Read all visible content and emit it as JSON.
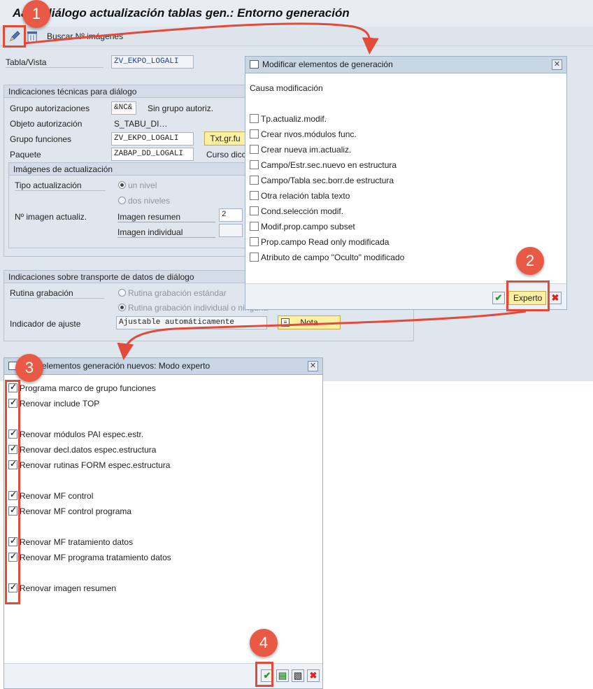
{
  "main": {
    "title": "Aa...l.diálogo actualización tablas gen.: Entorno generación",
    "toolbar": {
      "search_label": "Buscar Nº imágenes"
    },
    "table_view": {
      "label": "Tabla/Vista",
      "value": "ZV_EKPO_LOGALI"
    },
    "tech_group": {
      "title": "Indicaciones técnicas para diálogo",
      "auth_group_label": "Grupo autorizaciones",
      "auth_group_value": "&NC&",
      "auth_group_text": "Sin grupo autoriz.",
      "auth_object_label": "Objeto autorización",
      "auth_object_value": "S_TABU_DI…",
      "function_group_label": "Grupo funciones",
      "function_group_value": "ZV_EKPO_LOGALI",
      "function_group_button": "Txt.gr.fu",
      "package_label": "Paquete",
      "package_value": "ZABAP_DD_LOGALI",
      "package_text": "Curso dicc"
    },
    "images_group": {
      "title": "Imágenes de actualización",
      "update_type_label": "Tipo actualización",
      "one_level": "un nivel",
      "two_levels": "dos niveles",
      "image_no_label": "Nº imagen actualiz.",
      "summary_label": "Imagen resumen",
      "summary_value": "2",
      "single_label": "Imagen individual",
      "single_value": ""
    },
    "transport_group": {
      "title": "Indicaciones sobre transporte de datos de diálogo",
      "routine_label": "Rutina grabación",
      "routine_standard": "Rutina grabación estándar",
      "routine_individual": "Rutina grabación individual o ninguna",
      "adjust_label": "Indicador de ajuste",
      "adjust_value": "Ajustable automáticamente",
      "note_button": "Nota"
    }
  },
  "dialog1": {
    "title": "Modificar elementos de generación",
    "cause_label": "Causa modificación",
    "options": [
      "Tp.actualiz.modif.",
      "Crear nvos.módulos func.",
      "Crear nueva im.actualiz.",
      "Campo/Estr.sec.nuevo en estructura",
      "Campo/Tabla sec.borr.de estructura",
      "Otra relación tabla texto",
      "Cond.selección modif.",
      "Modif.prop.campo subset",
      "Prop.campo Read only modificada",
      "Atributo de campo \"Oculto\" modificado"
    ],
    "expert_button": "Experto"
  },
  "dialog2": {
    "title": "elementos generación nuevos: Modo experto",
    "options": [
      "Programa marco de grupo funciones",
      "Renovar include TOP",
      "Renovar módulos PAI espec.estr.",
      "Renovar decl.datos espec.estructura",
      "Renovar rutinas FORM espec.estructura",
      "Renovar MF control",
      "Renovar MF control programa",
      "Renovar MF tratamiento datos",
      "Renovar MF programa tratamiento datos",
      "Renovar imagen resumen"
    ]
  },
  "steps": [
    "1",
    "2",
    "3",
    "4"
  ],
  "colors": {
    "accent": "#e24a3a",
    "header": "#c9d6e6",
    "background": "#dfe6ee",
    "field_text": "#1b3fa6"
  }
}
